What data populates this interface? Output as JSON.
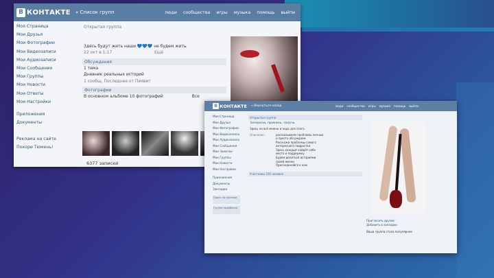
{
  "shot1": {
    "logo_letter": "B",
    "logo": "КОНТАКТЕ",
    "back": "« Список групп",
    "nav": [
      "люди",
      "сообщества",
      "игры",
      "музыка",
      "помощь",
      "выйти"
    ],
    "sidebar": [
      "Моя Страница",
      "Мои Друзья",
      "Мои Фотографии",
      "Мои Видеозаписи",
      "Мои Аудиозаписи",
      "Мои Сообщения",
      "Мои Группы",
      "Мои Новости",
      "Мои Ответы",
      "Мои Настройки",
      "Приложения",
      "Документы",
      "Реклама на сайте",
      "Покори Тюмень!"
    ],
    "group_type": "Открытая группа",
    "line1": "Здесь будут жить наши 💙💙💙 не будем жить",
    "line2": "22 окт в 1:17",
    "line2b": "Ещё",
    "discussions_header": "Обсуждения",
    "topics": "1 тема",
    "topic_title": "Дневник реальных историй",
    "topic_meta": "1 сообщ. Последнее от Пиявит",
    "photos_header": "Фотографии",
    "photos_line": "В основном альбоме 10 фотографий",
    "photos_all": "Все",
    "entries": "6377 записей"
  },
  "shot2": {
    "logo_letter": "B",
    "logo": "КОНТАКТЕ",
    "back": "« Вернуться назад",
    "nav": [
      "люди",
      "сообщества",
      "игры",
      "музыка",
      "помощь",
      "выйти"
    ],
    "sidebar": [
      "Моя Страница",
      "Мои Друзья",
      "Мои Фотографии",
      "Мои Видеозаписи",
      "Мои Аудиозаписи",
      "Мои Сообщения",
      "Мои Заметки",
      "Мои Группы",
      "Мои Новости",
      "Мои Настройки",
      "Приложения",
      "Документы",
      "Закладки"
    ],
    "box1": "Поиск по группам",
    "box2": "Группа подобрана",
    "header": "Открытая группа",
    "title": "Зачеркни, прикинь, захочь.",
    "desc": "Здесь на всё можно и надо для этого.",
    "desc_label": "Описание:",
    "desc_lines": [
      "рассказываем проблемы личные",
      "и просто обсуждаем",
      "Расскажи проблемы самого",
      "интересного подростка",
      "Здесь каждый найдёт себе",
      "место и поддержку",
      "Будем делиться историями",
      "своей жизни",
      "Присоединяйся к нам"
    ],
    "section": "Участники 100 человек",
    "right_link1": "Пригласить друзей",
    "right_link2": "Добавить в закладки",
    "right_text": "Ваша группа стала популярнее"
  }
}
